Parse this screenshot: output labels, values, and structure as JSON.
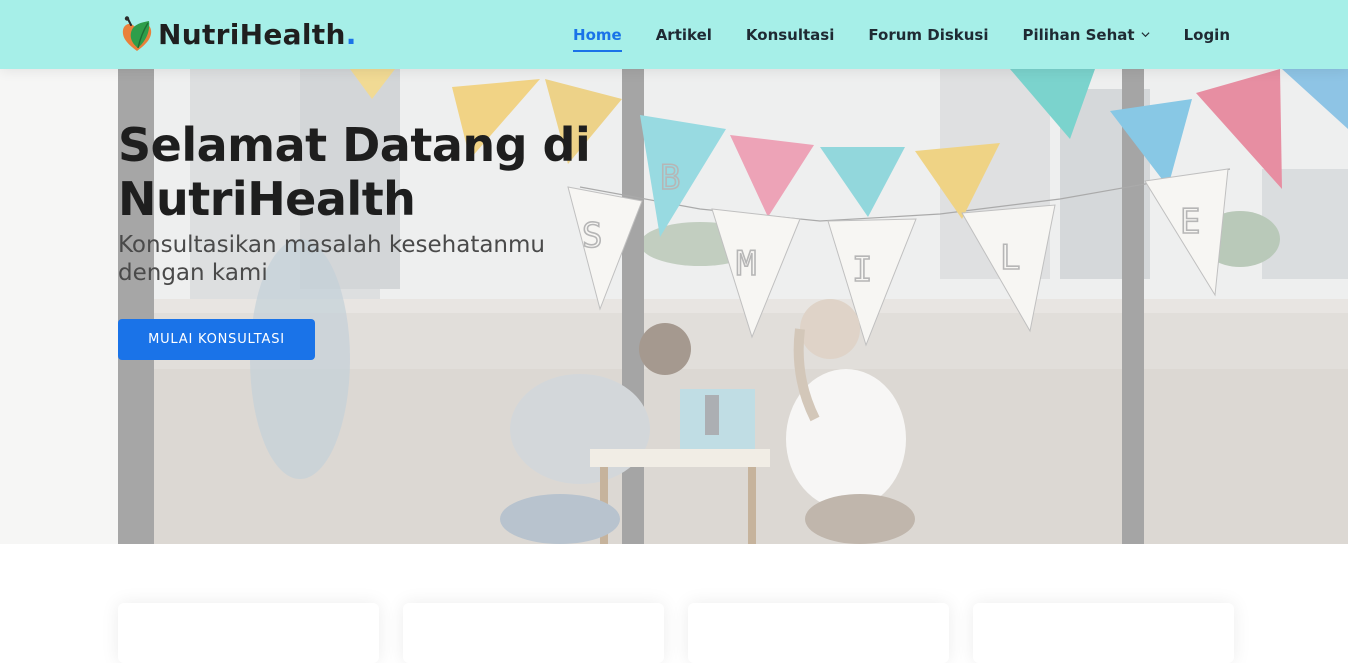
{
  "brand": {
    "name": "NutriHealth",
    "dot": ".",
    "logo_icon": "leaf-heart-icon"
  },
  "nav": {
    "items": [
      {
        "label": "Home",
        "active": true
      },
      {
        "label": "Artikel"
      },
      {
        "label": "Konsultasi"
      },
      {
        "label": "Forum Diskusi"
      },
      {
        "label": "Pilihan Sehat",
        "dropdown": true,
        "icon": "chevron-down-icon"
      },
      {
        "label": "Login"
      }
    ]
  },
  "hero": {
    "title": "Selamat Datang di NutriHealth",
    "subtitle": "Konsultasikan masalah kesehatanmu dengan kami",
    "cta_label": "MULAI KONSULTASI",
    "bunting_letters": [
      "B",
      "S",
      "M",
      "I",
      "L",
      "E"
    ]
  },
  "colors": {
    "header_bg": "#a6efe8",
    "accent": "#1a73e8",
    "text_dark": "#1e1e1e"
  }
}
